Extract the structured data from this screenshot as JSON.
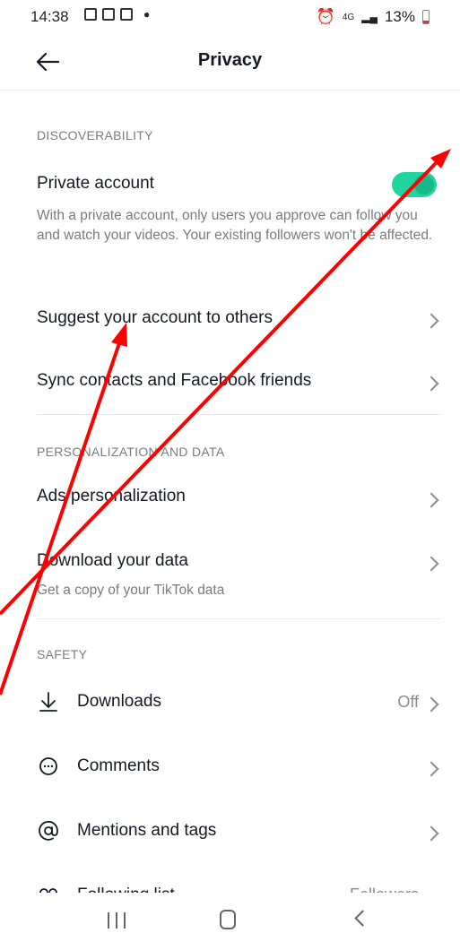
{
  "status_bar": {
    "time": "14:38",
    "network": "4G",
    "battery": "13%"
  },
  "header": {
    "title": "Privacy"
  },
  "discoverability": {
    "label": "DISCOVERABILITY",
    "private_account": {
      "label": "Private account",
      "enabled": true,
      "description": "With a private account, only users you approve can follow you and watch your videos. Your existing followers won't be affected."
    },
    "suggest": "Suggest your account to others",
    "sync": "Sync contacts and Facebook friends"
  },
  "personalization": {
    "label": "PERSONALIZATION AND DATA",
    "ads": "Ads personalization",
    "download": {
      "label": "Download your data",
      "description": "Get a copy of your TikTok data"
    }
  },
  "safety": {
    "label": "SAFETY",
    "downloads": {
      "label": "Downloads",
      "value": "Off"
    },
    "comments": "Comments",
    "mentions": "Mentions and tags",
    "following_list": {
      "label": "Following list",
      "value": "Followers"
    }
  },
  "colors": {
    "accent": "#20d5a0",
    "annotation_arrow": "#ff0000"
  }
}
